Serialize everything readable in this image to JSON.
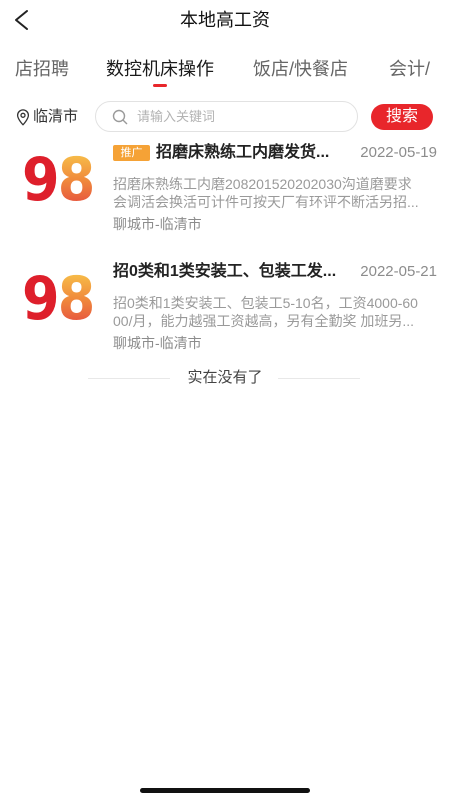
{
  "header": {
    "title": "本地高工资",
    "back_icon": "chevron-left-icon"
  },
  "tabs": [
    {
      "label": "店招聘",
      "active": false
    },
    {
      "label": "数控机床操作",
      "active": true
    },
    {
      "label": "饭店/快餐店",
      "active": false
    },
    {
      "label": "会计/",
      "active": false
    }
  ],
  "search": {
    "location_icon": "location-pin-icon",
    "location": "临清市",
    "search_icon": "search-icon",
    "placeholder": "请输入关键词",
    "button_label": "搜索"
  },
  "jobs": [
    {
      "logo_text": [
        "9",
        "8"
      ],
      "badge": "推广",
      "title": "招磨床熟练工内磨发货...",
      "date": "2022-05-19",
      "description_lines": [
        "招磨床熟练工内磨208201520202030沟道磨要求",
        "会调活会换活可计件可按天厂有环评不断活另招..."
      ],
      "location": "聊城市-临清市"
    },
    {
      "logo_text": [
        "9",
        "8"
      ],
      "title": "招0类和1类安装工、包装工发...",
      "date": "2022-05-21",
      "description_lines": [
        "招0类和1类安装工、包装工5-10名，工资4000-60",
        "00/月，能力越强工资越高，另有全勤奖 加班另..."
      ],
      "location": "聊城市-临清市"
    }
  ],
  "end_text": "实在没有了",
  "colors": {
    "accent": "#e8262b",
    "badge": "#f5a236",
    "logo_red": "#de1f2b"
  }
}
